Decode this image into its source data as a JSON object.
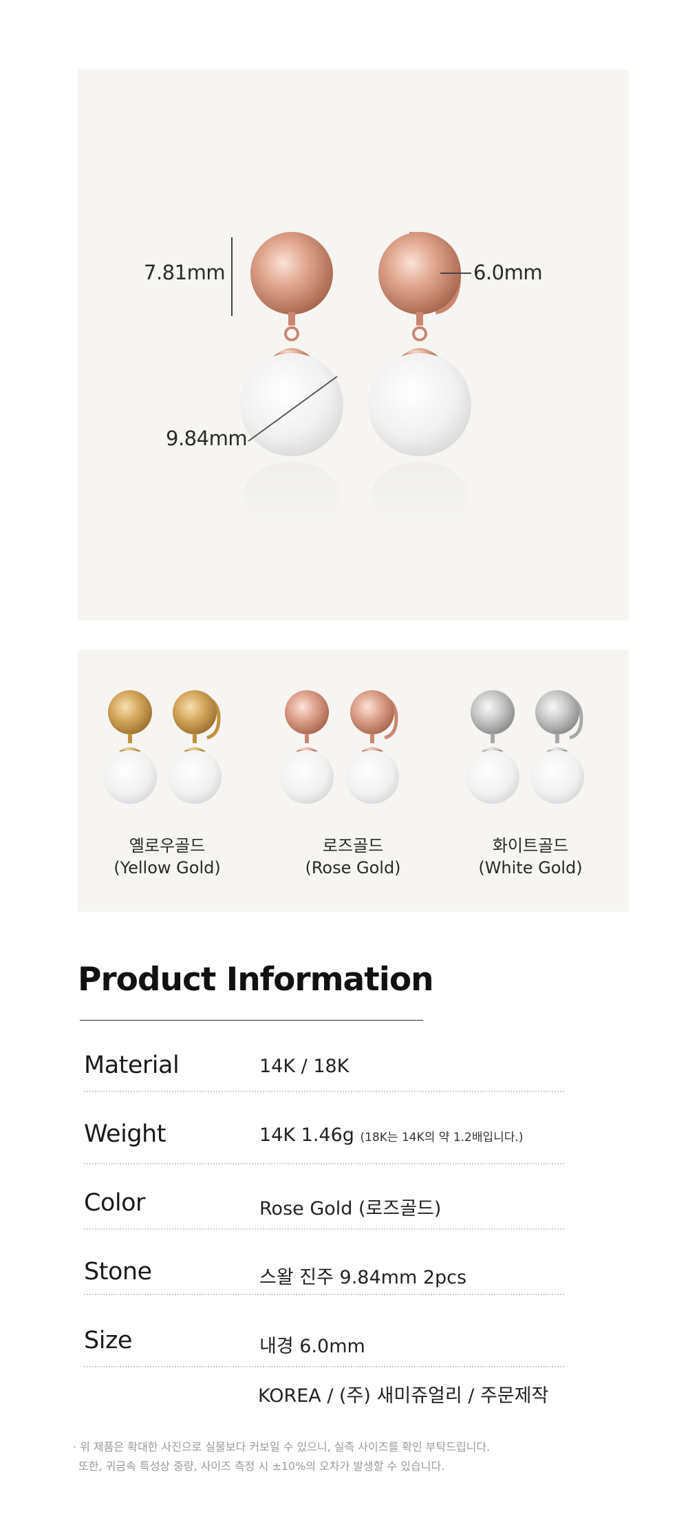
{
  "hero": {
    "ball_dimension": "7.81mm",
    "hoop_dimension": "6.0mm",
    "pearl_dimension": "9.84mm"
  },
  "variants": [
    {
      "name_ko": "옐로우골드",
      "name_en": "(Yellow Gold)",
      "metal_color": "#d4a65a"
    },
    {
      "name_ko": "로즈골드",
      "name_en": "(Rose Gold)",
      "metal_color": "#dca08a"
    },
    {
      "name_ko": "화이트골드",
      "name_en": "(White Gold)",
      "metal_color": "#c8c8c8"
    }
  ],
  "product_info": {
    "title": "Product Information",
    "rows": [
      {
        "label": "Material",
        "value": "14K / 18K",
        "note": ""
      },
      {
        "label": "Weight",
        "value": "14K 1.46g",
        "note": "(18K는 14K의 약 1.2배입니다.)"
      },
      {
        "label": "Color",
        "value": "Rose Gold (로즈골드)",
        "note": ""
      },
      {
        "label": "Stone",
        "value": "스왈 진주 9.84mm 2pcs",
        "note": ""
      },
      {
        "label": "Size",
        "value": "내경 6.0mm",
        "note": ""
      }
    ],
    "origin": "KOREA / (주) 새미쥬얼리 / 주문제작"
  },
  "notes": [
    "· 위 제품은 확대한 사진으로 실물보다 커보일 수 있으니, 실측 사이즈를 확인 부탁드립니다.",
    "또한, 귀금속 특성상 중량, 사이즈 측정 시 ±10%의 오차가 발생할 수 있습니다."
  ],
  "colors": {
    "panel_bg": "#f6f5f2",
    "rose_gold": "#dca08a",
    "pearl": "#f4f4f4"
  }
}
